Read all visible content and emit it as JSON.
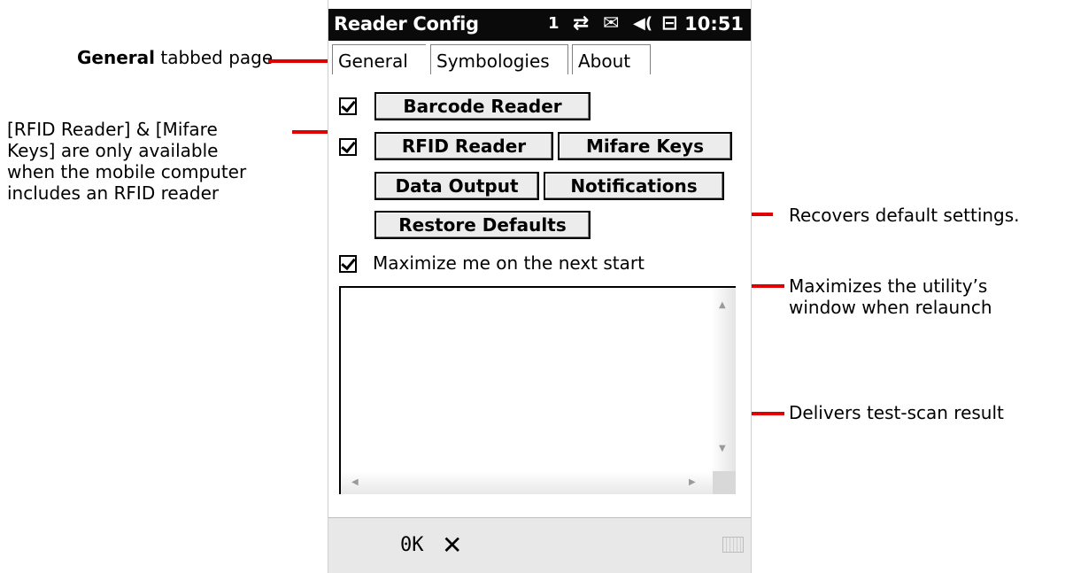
{
  "annotations": {
    "general_bold": "General",
    "general_rest": " tabbed page",
    "rfid_line1": "[RFID Reader] & [Mifare",
    "rfid_line2": "Keys] are only available",
    "rfid_line3": "when the mobile computer",
    "rfid_line4": "includes an RFID reader",
    "restore_note": "Recovers default settings.",
    "maximize_line1": "Maximizes the utility’s",
    "maximize_line2": "window when relaunch",
    "result_note": "Delivers test-scan result"
  },
  "statusbar": {
    "title": "Reader Config",
    "signal": "1",
    "sync_icon": "⇄",
    "message_icon": "✉",
    "volume_icon": "◀(",
    "battery_icon": "⊟",
    "time": "10:51"
  },
  "tabs": [
    "General",
    "Symbologies",
    "About"
  ],
  "buttons": {
    "barcode_reader": "Barcode Reader",
    "rfid_reader": "RFID Reader",
    "mifare_keys": "Mifare Keys",
    "data_output": "Data Output",
    "notifications": "Notifications",
    "restore_defaults": "Restore Defaults"
  },
  "maximize_label": "Maximize me on the next start",
  "checkboxes": {
    "barcode": true,
    "rfid": true,
    "maximize": true
  },
  "bottombar": {
    "ok": "0K",
    "close": "✕"
  },
  "colors": {
    "annotation_line": "#e00000",
    "statusbar": "#0a0a0a"
  }
}
